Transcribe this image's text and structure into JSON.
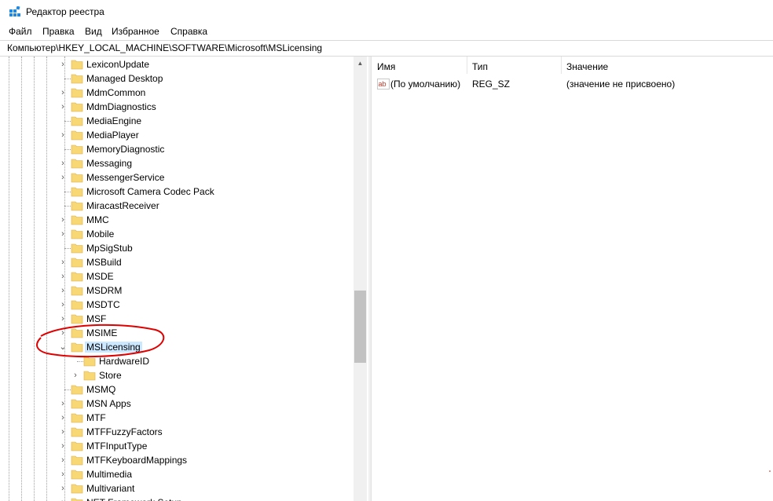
{
  "window": {
    "title": "Редактор реестра",
    "icon": "regedit-icon"
  },
  "menu": [
    "Файл",
    "Правка",
    "Вид",
    "Избранное",
    "Справка"
  ],
  "address": "Компьютер\\HKEY_LOCAL_MACHINE\\SOFTWARE\\Microsoft\\MSLicensing",
  "tree": {
    "nodes": [
      {
        "label": "LexiconUpdate",
        "expander": "›"
      },
      {
        "label": "Managed Desktop",
        "expander": ""
      },
      {
        "label": "MdmCommon",
        "expander": "›"
      },
      {
        "label": "MdmDiagnostics",
        "expander": "›"
      },
      {
        "label": "MediaEngine",
        "expander": ""
      },
      {
        "label": "MediaPlayer",
        "expander": "›"
      },
      {
        "label": "MemoryDiagnostic",
        "expander": ""
      },
      {
        "label": "Messaging",
        "expander": "›"
      },
      {
        "label": "MessengerService",
        "expander": "›"
      },
      {
        "label": "Microsoft Camera Codec Pack",
        "expander": ""
      },
      {
        "label": "MiracastReceiver",
        "expander": ""
      },
      {
        "label": "MMC",
        "expander": "›"
      },
      {
        "label": "Mobile",
        "expander": "›"
      },
      {
        "label": "MpSigStub",
        "expander": ""
      },
      {
        "label": "MSBuild",
        "expander": "›"
      },
      {
        "label": "MSDE",
        "expander": "›"
      },
      {
        "label": "MSDRM",
        "expander": "›"
      },
      {
        "label": "MSDTC",
        "expander": "›"
      },
      {
        "label": "MSF",
        "expander": "›"
      },
      {
        "label": "MSIME",
        "expander": "›"
      },
      {
        "label": "MSLicensing",
        "expander": "⌄",
        "selected": true
      },
      {
        "label": "HardwareID",
        "expander": "",
        "child": true
      },
      {
        "label": "Store",
        "expander": "›",
        "child": true
      },
      {
        "label": "MSMQ",
        "expander": ""
      },
      {
        "label": "MSN Apps",
        "expander": "›"
      },
      {
        "label": "MTF",
        "expander": "›"
      },
      {
        "label": "MTFFuzzyFactors",
        "expander": "›"
      },
      {
        "label": "MTFInputType",
        "expander": "›"
      },
      {
        "label": "MTFKeyboardMappings",
        "expander": "›"
      },
      {
        "label": "Multimedia",
        "expander": "›"
      },
      {
        "label": "Multivariant",
        "expander": "›"
      },
      {
        "label": "NET Framework Setup",
        "expander": "›"
      }
    ]
  },
  "list": {
    "columns": [
      "Имя",
      "Тип",
      "Значение"
    ],
    "rows": [
      {
        "name": "(По умолчанию)",
        "type": "REG_SZ",
        "value": "(значение не присвоено)",
        "icon": "string-value-icon"
      }
    ]
  },
  "colors": {
    "selection": "#cce8ff",
    "folder": "#f8d775",
    "annotation": "#e00000"
  }
}
